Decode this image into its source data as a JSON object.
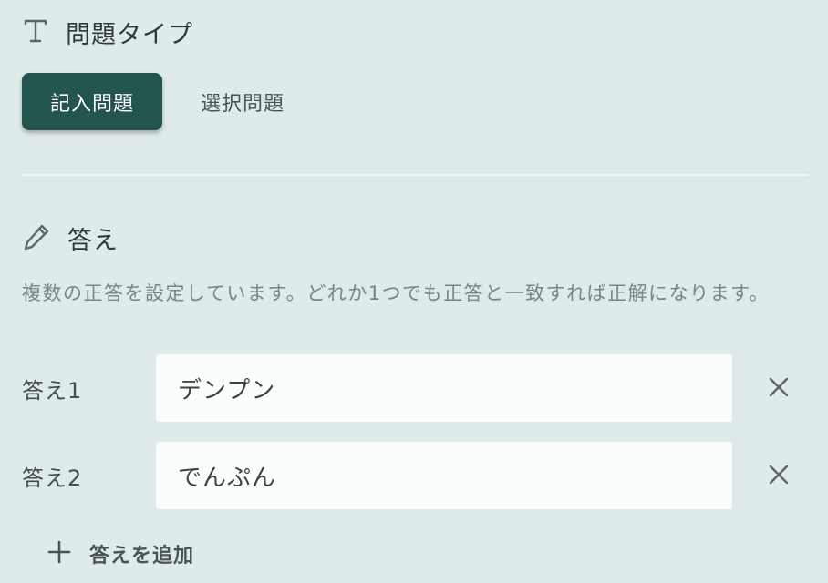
{
  "question_type": {
    "icon": "text-t-icon",
    "title": "問題タイプ",
    "tabs": [
      {
        "label": "記入問題",
        "active": true
      },
      {
        "label": "選択問題",
        "active": false
      }
    ]
  },
  "answers": {
    "icon": "pencil-icon",
    "title": "答え",
    "description": "複数の正答を設定しています。どれか1つでも正答と一致すれば正解になります。",
    "items": [
      {
        "label": "答え1",
        "value": "デンプン"
      },
      {
        "label": "答え2",
        "value": "でんぷん"
      }
    ],
    "remove_icon": "close-icon",
    "add_icon": "plus-icon",
    "add_label": "答えを追加"
  },
  "colors": {
    "background": "#dfeaea",
    "active_tab": "#23544e",
    "input_background": "#f9fefc"
  }
}
